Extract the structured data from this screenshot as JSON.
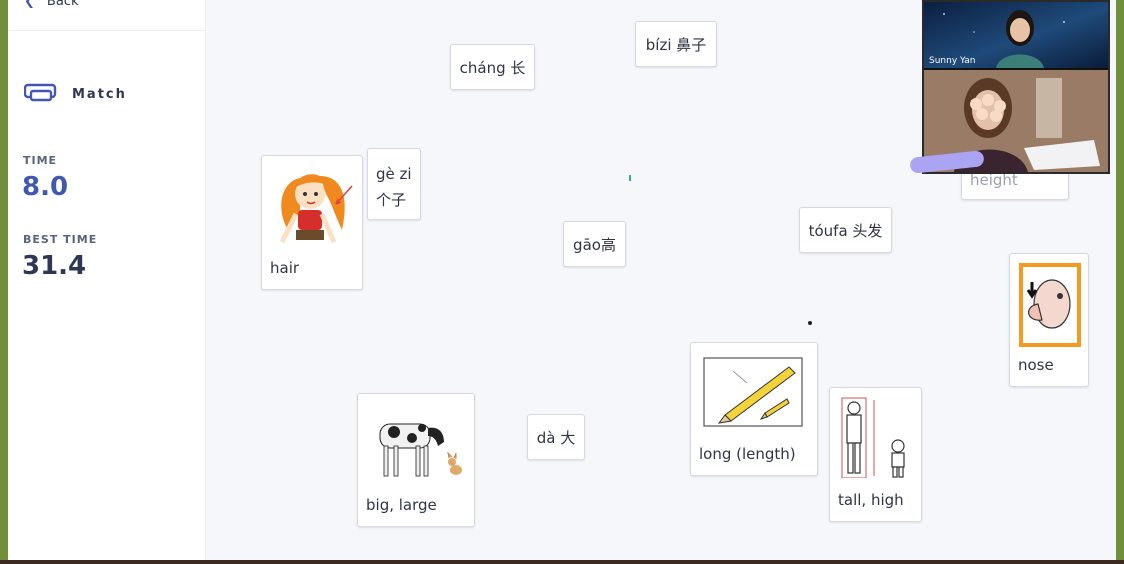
{
  "sidebar": {
    "back_label": "Back",
    "mode_title": "Match",
    "time_label": "TIME",
    "time_value": "8.0",
    "best_time_label": "BEST TIME",
    "best_time_value": "31.4"
  },
  "cards": {
    "chang": "cháng 长",
    "bizi": "bízi 鼻子",
    "gezi_line1": "gè zi",
    "gezi_line2": "个子",
    "gao": "gāo高",
    "toufa": "tóufa 头发",
    "da": "dà 大",
    "height": "height",
    "hair": "hair",
    "nose": "nose",
    "big": "big, large",
    "long": "long (length)",
    "tall": "tall, high"
  },
  "video": {
    "participant_name": "Sunny Yan"
  },
  "colors": {
    "accent": "#4257b2",
    "text_dark": "#2e3856",
    "text_muted": "#586380",
    "card_border": "#d6d9e3"
  }
}
